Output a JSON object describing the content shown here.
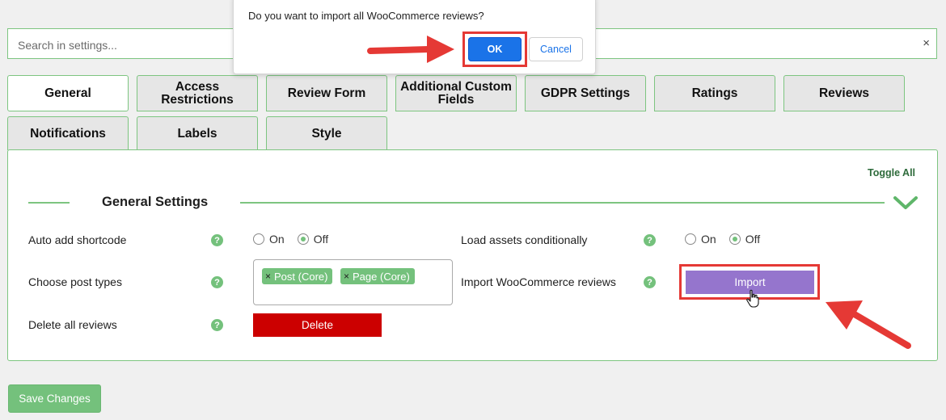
{
  "search": {
    "placeholder": "Search in settings...",
    "clear_glyph": "×"
  },
  "tabs": [
    {
      "label": "General",
      "active": true
    },
    {
      "label": "Access Restrictions"
    },
    {
      "label": "Review Form"
    },
    {
      "label": "Additional Custom Fields"
    },
    {
      "label": "GDPR Settings"
    },
    {
      "label": "Ratings"
    },
    {
      "label": "Reviews"
    },
    {
      "label": "Notifications"
    },
    {
      "label": "Labels"
    },
    {
      "label": "Style"
    }
  ],
  "panel": {
    "toggle_all": "Toggle All",
    "section_title": "General Settings",
    "settings": {
      "auto_add_shortcode": {
        "label": "Auto add shortcode",
        "on": "On",
        "off": "Off",
        "value": "Off"
      },
      "load_assets": {
        "label": "Load assets conditionally",
        "on": "On",
        "off": "Off",
        "value": "Off"
      },
      "post_types": {
        "label": "Choose post types",
        "chips": [
          "Post (Core)",
          "Page (Core)"
        ],
        "remove_glyph": "×"
      },
      "import": {
        "label": "Import WooCommerce reviews",
        "button": "Import"
      },
      "delete": {
        "label": "Delete all reviews",
        "button": "Delete"
      }
    },
    "help_glyph": "?"
  },
  "footer": {
    "save_button": "Save Changes"
  },
  "dialog": {
    "message": "Do you want to import all WooCommerce reviews?",
    "ok": "OK",
    "cancel": "Cancel"
  },
  "colors": {
    "accent_green": "#74c17c",
    "border_green": "#7dc580",
    "delete_red": "#cc0000",
    "import_purple": "#9575cd",
    "highlight_red": "#e53935",
    "dialog_blue": "#1a73e8"
  }
}
